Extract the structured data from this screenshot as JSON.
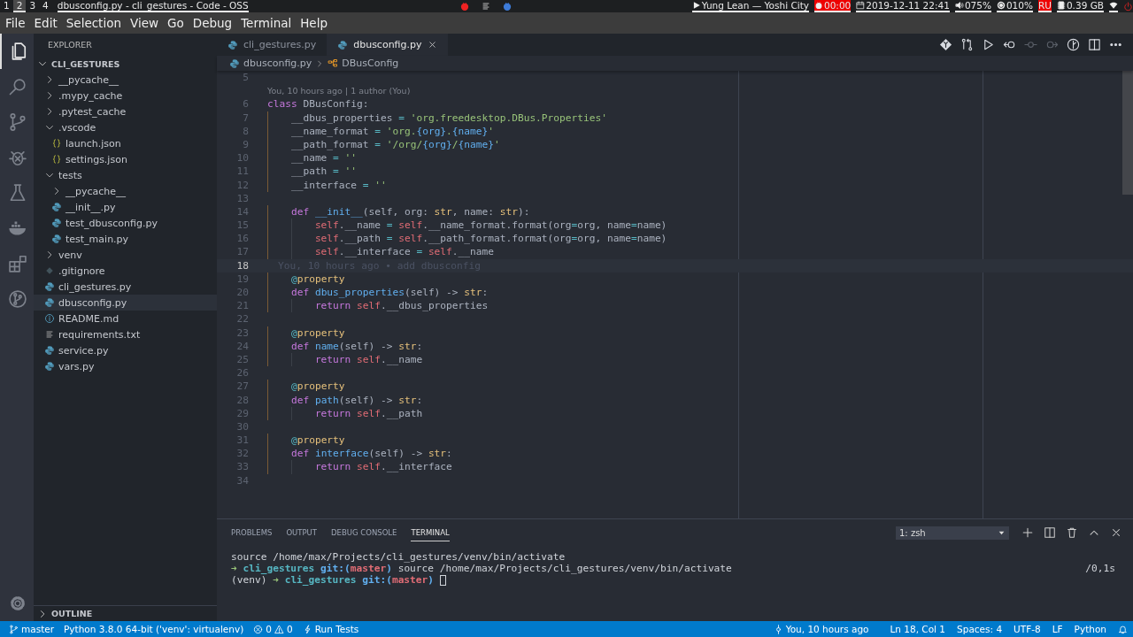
{
  "system_bar": {
    "workspaces": [
      {
        "label": "1",
        "selected": false
      },
      {
        "label": "2",
        "selected": true
      },
      {
        "label": "3",
        "selected": false
      },
      {
        "label": "4",
        "selected": false
      }
    ],
    "window_title": "dbusconfig.py - cli_gestures - Code - OSS",
    "now_playing": "Yung Lean — Yoshi City",
    "timer": "00:00",
    "datetime": "2019-12-11 22:41",
    "volume": "075%",
    "brightness": "010%",
    "keyboard_layout": "RU",
    "memory": "0.39 GB"
  },
  "menu": [
    "File",
    "Edit",
    "Selection",
    "View",
    "Go",
    "Debug",
    "Terminal",
    "Help"
  ],
  "activity_bar": [
    {
      "kind": "explorer",
      "selected": true
    },
    {
      "kind": "search",
      "selected": false
    },
    {
      "kind": "scm",
      "selected": false
    },
    {
      "kind": "debug",
      "selected": false
    },
    {
      "kind": "test",
      "selected": false
    },
    {
      "kind": "docker",
      "selected": false
    },
    {
      "kind": "extensions",
      "selected": false
    },
    {
      "kind": "history",
      "selected": false
    }
  ],
  "explorer": {
    "title": "EXPLORER",
    "folder": {
      "label": "CLI_GESTURES",
      "expanded": true
    },
    "items": [
      {
        "label": "__pycache__",
        "kind": "folder",
        "expanded": false,
        "selected": false
      },
      {
        "label": ".mypy_cache",
        "kind": "folder",
        "expanded": false,
        "selected": false
      },
      {
        "label": ".pytest_cache",
        "kind": "folder",
        "expanded": false,
        "selected": false
      },
      {
        "label": ".vscode",
        "kind": "folder",
        "expanded": true,
        "selected": false,
        "children": [
          {
            "label": "launch.json",
            "kind": "json",
            "selected": false
          },
          {
            "label": "settings.json",
            "kind": "json",
            "selected": false
          }
        ]
      },
      {
        "label": "tests",
        "kind": "folder",
        "expanded": true,
        "selected": false,
        "children": [
          {
            "label": "__pycache__",
            "kind": "folder",
            "expanded": false,
            "selected": false
          },
          {
            "label": "__init__.py",
            "kind": "python",
            "selected": false
          },
          {
            "label": "test_dbusconfig.py",
            "kind": "python",
            "selected": false
          },
          {
            "label": "test_main.py",
            "kind": "python",
            "selected": false
          }
        ]
      },
      {
        "label": "venv",
        "kind": "folder",
        "expanded": false,
        "selected": false
      },
      {
        "label": ".gitignore",
        "kind": "git",
        "selected": false
      },
      {
        "label": "cli_gestures.py",
        "kind": "python",
        "selected": false
      },
      {
        "label": "dbusconfig.py",
        "kind": "python",
        "selected": true
      },
      {
        "label": "README.md",
        "kind": "info",
        "selected": false
      },
      {
        "label": "requirements.txt",
        "kind": "text",
        "selected": false
      },
      {
        "label": "service.py",
        "kind": "python",
        "selected": false
      },
      {
        "label": "vars.py",
        "kind": "python",
        "selected": false
      }
    ],
    "outline": {
      "label": "OUTLINE",
      "expanded": false
    }
  },
  "tabs": [
    {
      "label": "cli_gestures.py",
      "selected": false
    },
    {
      "label": "dbusconfig.py",
      "selected": true
    }
  ],
  "editor_actions": [
    {
      "kind": "open-changes",
      "disabled": false
    },
    {
      "kind": "compare",
      "disabled": false
    },
    {
      "kind": "run",
      "disabled": false
    },
    {
      "kind": "previous-change",
      "disabled": false
    },
    {
      "kind": "current-change",
      "disabled": true
    },
    {
      "kind": "next-change",
      "disabled": true
    },
    {
      "kind": "history",
      "disabled": false
    },
    {
      "kind": "split",
      "disabled": false
    },
    {
      "kind": "more",
      "disabled": false
    }
  ],
  "breadcrumb": [
    "dbusconfig.py",
    "DBusConfig"
  ],
  "editor": {
    "lines": [
      {
        "kind": "code",
        "number": "5",
        "current": false
      },
      {
        "kind": "codelens",
        "text": "You, 10 hours ago | 1 author (You)"
      },
      {
        "kind": "code",
        "number": "6",
        "current": false,
        "tokens": [
          {
            "text": "class",
            "kind": "keyword"
          },
          {
            "text": " DBusConfig:",
            "kind": "plain"
          }
        ]
      },
      {
        "kind": "code",
        "number": "7",
        "current": false,
        "tokens": [
          {
            "text": "    __dbus_properties ",
            "kind": "plain"
          },
          {
            "text": "= ",
            "kind": "operator"
          },
          {
            "text": "'org.freedesktop.DBus.Properties'",
            "kind": "string"
          }
        ]
      },
      {
        "kind": "code",
        "number": "8",
        "current": false,
        "tokens": [
          {
            "text": "    __name_format ",
            "kind": "plain"
          },
          {
            "text": "= ",
            "kind": "operator"
          },
          {
            "text": "'org.",
            "kind": "string"
          },
          {
            "text": "{org}",
            "kind": "format"
          },
          {
            "text": ".",
            "kind": "string"
          },
          {
            "text": "{name}",
            "kind": "format"
          },
          {
            "text": "'",
            "kind": "string"
          }
        ]
      },
      {
        "kind": "code",
        "number": "9",
        "current": false,
        "tokens": [
          {
            "text": "    __path_format ",
            "kind": "plain"
          },
          {
            "text": "= ",
            "kind": "operator"
          },
          {
            "text": "'/org/",
            "kind": "string"
          },
          {
            "text": "{org}",
            "kind": "format"
          },
          {
            "text": "/",
            "kind": "string"
          },
          {
            "text": "{name}",
            "kind": "format"
          },
          {
            "text": "'",
            "kind": "string"
          }
        ]
      },
      {
        "kind": "code",
        "number": "10",
        "current": false,
        "tokens": [
          {
            "text": "    __name ",
            "kind": "plain"
          },
          {
            "text": "= ",
            "kind": "operator"
          },
          {
            "text": "''",
            "kind": "string"
          }
        ]
      },
      {
        "kind": "code",
        "number": "11",
        "current": false,
        "tokens": [
          {
            "text": "    __path ",
            "kind": "plain"
          },
          {
            "text": "= ",
            "kind": "operator"
          },
          {
            "text": "''",
            "kind": "string"
          }
        ]
      },
      {
        "kind": "code",
        "number": "12",
        "current": false,
        "tokens": [
          {
            "text": "    __interface ",
            "kind": "plain"
          },
          {
            "text": "= ",
            "kind": "operator"
          },
          {
            "text": "''",
            "kind": "string"
          }
        ]
      },
      {
        "kind": "code",
        "number": "13",
        "current": false
      },
      {
        "kind": "code",
        "number": "14",
        "current": false,
        "tokens": [
          {
            "text": "    def ",
            "kind": "keyword"
          },
          {
            "text": "__init__",
            "kind": "function"
          },
          {
            "text": "(self, org: ",
            "kind": "plain"
          },
          {
            "text": "str",
            "kind": "builtin"
          },
          {
            "text": ", name: ",
            "kind": "plain"
          },
          {
            "text": "str",
            "kind": "builtin"
          },
          {
            "text": "):",
            "kind": "plain"
          }
        ]
      },
      {
        "kind": "code",
        "number": "15",
        "current": false,
        "tokens": [
          {
            "text": "        self",
            "kind": "self"
          },
          {
            "text": ".__name ",
            "kind": "plain"
          },
          {
            "text": "= ",
            "kind": "operator"
          },
          {
            "text": "self",
            "kind": "self"
          },
          {
            "text": ".__name_format.format(org",
            "kind": "plain"
          },
          {
            "text": "=",
            "kind": "operator"
          },
          {
            "text": "org, name",
            "kind": "plain"
          },
          {
            "text": "=",
            "kind": "operator"
          },
          {
            "text": "name)",
            "kind": "plain"
          }
        ]
      },
      {
        "kind": "code",
        "number": "16",
        "current": false,
        "tokens": [
          {
            "text": "        self",
            "kind": "self"
          },
          {
            "text": ".__path ",
            "kind": "plain"
          },
          {
            "text": "= ",
            "kind": "operator"
          },
          {
            "text": "self",
            "kind": "self"
          },
          {
            "text": ".__path_format.format(org",
            "kind": "plain"
          },
          {
            "text": "=",
            "kind": "operator"
          },
          {
            "text": "org, name",
            "kind": "plain"
          },
          {
            "text": "=",
            "kind": "operator"
          },
          {
            "text": "name)",
            "kind": "plain"
          }
        ]
      },
      {
        "kind": "code",
        "number": "17",
        "current": false,
        "tokens": [
          {
            "text": "        self",
            "kind": "self"
          },
          {
            "text": ".__interface ",
            "kind": "plain"
          },
          {
            "text": "= ",
            "kind": "operator"
          },
          {
            "text": "self",
            "kind": "self"
          },
          {
            "text": ".__name",
            "kind": "plain"
          }
        ]
      },
      {
        "kind": "code",
        "number": "18",
        "current": true,
        "blame": "You, 10 hours ago • add dbusconfig"
      },
      {
        "kind": "code",
        "number": "19",
        "current": false,
        "tokens": [
          {
            "text": "    @",
            "kind": "decorator"
          },
          {
            "text": "property",
            "kind": "builtin"
          }
        ]
      },
      {
        "kind": "code",
        "number": "20",
        "current": false,
        "tokens": [
          {
            "text": "    def ",
            "kind": "keyword"
          },
          {
            "text": "dbus_properties",
            "kind": "function"
          },
          {
            "text": "(self) -> ",
            "kind": "plain"
          },
          {
            "text": "str",
            "kind": "builtin"
          },
          {
            "text": ":",
            "kind": "plain"
          }
        ]
      },
      {
        "kind": "code",
        "number": "21",
        "current": false,
        "tokens": [
          {
            "text": "        return ",
            "kind": "keyword"
          },
          {
            "text": "self",
            "kind": "self"
          },
          {
            "text": ".__dbus_properties",
            "kind": "plain"
          }
        ]
      },
      {
        "kind": "code",
        "number": "22",
        "current": false
      },
      {
        "kind": "code",
        "number": "23",
        "current": false,
        "tokens": [
          {
            "text": "    @",
            "kind": "decorator"
          },
          {
            "text": "property",
            "kind": "builtin"
          }
        ]
      },
      {
        "kind": "code",
        "number": "24",
        "current": false,
        "tokens": [
          {
            "text": "    def ",
            "kind": "keyword"
          },
          {
            "text": "name",
            "kind": "function"
          },
          {
            "text": "(self) -> ",
            "kind": "plain"
          },
          {
            "text": "str",
            "kind": "builtin"
          },
          {
            "text": ":",
            "kind": "plain"
          }
        ]
      },
      {
        "kind": "code",
        "number": "25",
        "current": false,
        "tokens": [
          {
            "text": "        return ",
            "kind": "keyword"
          },
          {
            "text": "self",
            "kind": "self"
          },
          {
            "text": ".__name",
            "kind": "plain"
          }
        ]
      },
      {
        "kind": "code",
        "number": "26",
        "current": false
      },
      {
        "kind": "code",
        "number": "27",
        "current": false,
        "tokens": [
          {
            "text": "    @",
            "kind": "decorator"
          },
          {
            "text": "property",
            "kind": "builtin"
          }
        ]
      },
      {
        "kind": "code",
        "number": "28",
        "current": false,
        "tokens": [
          {
            "text": "    def ",
            "kind": "keyword"
          },
          {
            "text": "path",
            "kind": "function"
          },
          {
            "text": "(self) -> ",
            "kind": "plain"
          },
          {
            "text": "str",
            "kind": "builtin"
          },
          {
            "text": ":",
            "kind": "plain"
          }
        ]
      },
      {
        "kind": "code",
        "number": "29",
        "current": false,
        "tokens": [
          {
            "text": "        return ",
            "kind": "keyword"
          },
          {
            "text": "self",
            "kind": "self"
          },
          {
            "text": ".__path",
            "kind": "plain"
          }
        ]
      },
      {
        "kind": "code",
        "number": "30",
        "current": false
      },
      {
        "kind": "code",
        "number": "31",
        "current": false,
        "tokens": [
          {
            "text": "    @",
            "kind": "decorator"
          },
          {
            "text": "property",
            "kind": "builtin"
          }
        ]
      },
      {
        "kind": "code",
        "number": "32",
        "current": false,
        "tokens": [
          {
            "text": "    def ",
            "kind": "keyword"
          },
          {
            "text": "interface",
            "kind": "function"
          },
          {
            "text": "(self) -> ",
            "kind": "plain"
          },
          {
            "text": "str",
            "kind": "builtin"
          },
          {
            "text": ":",
            "kind": "plain"
          }
        ]
      },
      {
        "kind": "code",
        "number": "33",
        "current": false,
        "tokens": [
          {
            "text": "        return ",
            "kind": "keyword"
          },
          {
            "text": "self",
            "kind": "self"
          },
          {
            "text": ".__interface",
            "kind": "plain"
          }
        ]
      },
      {
        "kind": "code",
        "number": "34",
        "current": false
      }
    ]
  },
  "panel": {
    "tabs": [
      {
        "label": "PROBLEMS",
        "selected": false
      },
      {
        "label": "OUTPUT",
        "selected": false
      },
      {
        "label": "DEBUG CONSOLE",
        "selected": false
      },
      {
        "label": "TERMINAL",
        "selected": true
      }
    ],
    "terminal_select": "1: zsh",
    "terminal": [
      {
        "segments": [
          {
            "text": "source /home/max/Projects/cli_gestures/venv/bin/activate",
            "kind": "plain"
          }
        ]
      },
      {
        "segments": [
          {
            "text": "➜ ",
            "kind": "arrow"
          },
          {
            "text": "cli_gestures ",
            "kind": "dir"
          },
          {
            "text": "git:(",
            "kind": "git"
          },
          {
            "text": "master",
            "kind": "branch"
          },
          {
            "text": ") ",
            "kind": "git"
          },
          {
            "text": "source /home/max/Projects/cli_gestures/venv/bin/activate",
            "kind": "plain"
          }
        ],
        "right": "/0,1s"
      },
      {
        "segments": [
          {
            "text": "(venv) ",
            "kind": "plain"
          },
          {
            "text": "➜ ",
            "kind": "arrow"
          },
          {
            "text": "cli_gestures ",
            "kind": "dir"
          },
          {
            "text": "git:(",
            "kind": "git"
          },
          {
            "text": "master",
            "kind": "branch"
          },
          {
            "text": ") ",
            "kind": "git"
          }
        ],
        "cursor": true
      }
    ]
  },
  "status_bar": {
    "branch": "master",
    "interpreter": "Python 3.8.0 64-bit ('venv': virtualenv)",
    "errors": "0",
    "warnings": "0",
    "run_tests": "Run Tests",
    "blame": "You, 10 hours ago",
    "position": "Ln 18, Col 1",
    "indentation": "Spaces: 4",
    "encoding": "UTF-8",
    "eol": "LF",
    "language": "Python"
  }
}
